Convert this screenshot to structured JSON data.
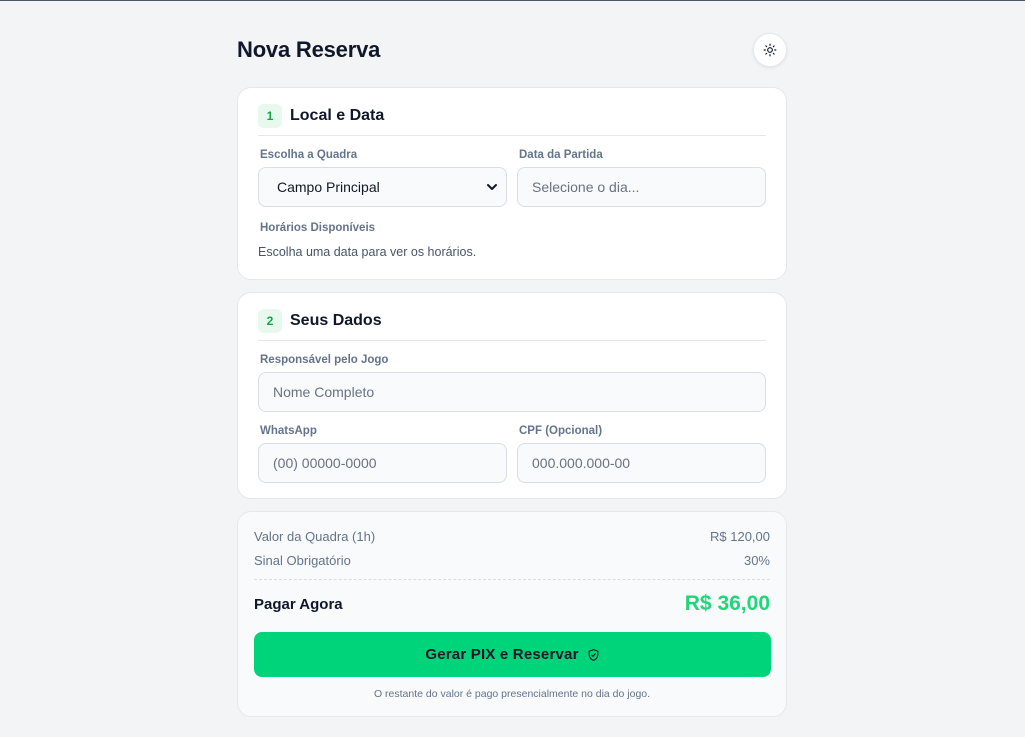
{
  "header": {
    "title": "Nova Reserva",
    "theme_icon": "sun-icon"
  },
  "section1": {
    "step": "1",
    "title": "Local e Data",
    "court_label": "Escolha a Quadra",
    "court_value": "Campo Principal",
    "date_label": "Data da Partida",
    "date_placeholder": "Selecione o dia...",
    "times_label": "Horários Disponíveis",
    "times_helper": "Escolha uma data para ver os horários."
  },
  "section2": {
    "step": "2",
    "title": "Seus Dados",
    "name_label": "Responsável pelo Jogo",
    "name_placeholder": "Nome Completo",
    "whatsapp_label": "WhatsApp",
    "whatsapp_placeholder": "(00) 00000-0000",
    "cpf_label": "CPF (Opcional)",
    "cpf_placeholder": "000.000.000-00"
  },
  "summary": {
    "court_price_label": "Valor da Quadra (1h)",
    "court_price_value": "R$ 120,00",
    "deposit_label": "Sinal Obrigatório",
    "deposit_value": "30%",
    "total_label": "Pagar Agora",
    "total_value": "R$ 36,00",
    "cta_label": "Gerar PIX e Reservar",
    "cta_icon": "shield-check-icon",
    "footnote": "O restante do valor é pago presencialmente no dia do jogo."
  },
  "colors": {
    "accent": "#00d47a",
    "total": "#1fd67a",
    "background": "#f3f4f6"
  }
}
